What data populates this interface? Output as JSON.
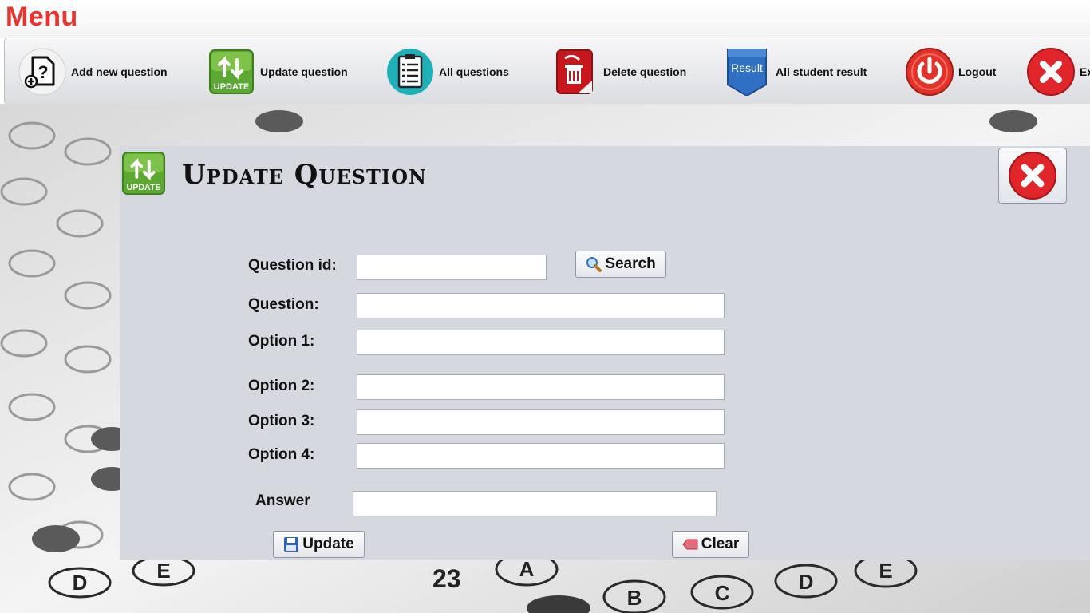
{
  "window": {
    "menu_title": "Menu"
  },
  "toolbar": {
    "items": [
      {
        "label": "Add new question",
        "icon": "add-question-icon"
      },
      {
        "label": "Update question",
        "icon": "update-icon"
      },
      {
        "label": "All questions",
        "icon": "list-icon"
      },
      {
        "label": "Delete question",
        "icon": "trash-icon"
      },
      {
        "label": "All student result",
        "icon": "result-ribbon-icon"
      },
      {
        "label": "Logout",
        "icon": "power-icon"
      },
      {
        "label": "Ex",
        "icon": "close-icon"
      }
    ]
  },
  "panel": {
    "title": "Update Question",
    "update_badge_text": "UPDATE",
    "form": {
      "question_id_label": "Question id:",
      "question_label": "Question:",
      "option1_label": "Option 1:",
      "option2_label": "Option 2:",
      "option3_label": "Option 3:",
      "option4_label": "Option 4:",
      "answer_label": "Answer",
      "question_id_value": "",
      "question_value": "",
      "option1_value": "",
      "option2_value": "",
      "option3_value": "",
      "option4_value": "",
      "answer_value": ""
    },
    "buttons": {
      "search_label": "Search",
      "update_label": "Update",
      "clear_label": "Clear"
    }
  },
  "background": {
    "sheet_texts": [
      "23",
      "A",
      "B",
      "C",
      "D",
      "E",
      "D",
      "E"
    ]
  },
  "colors": {
    "menu_title": "#e8332e",
    "panel_bg": "#d6d8df",
    "close_red": "#e0262b",
    "update_green": "#5ba832"
  }
}
